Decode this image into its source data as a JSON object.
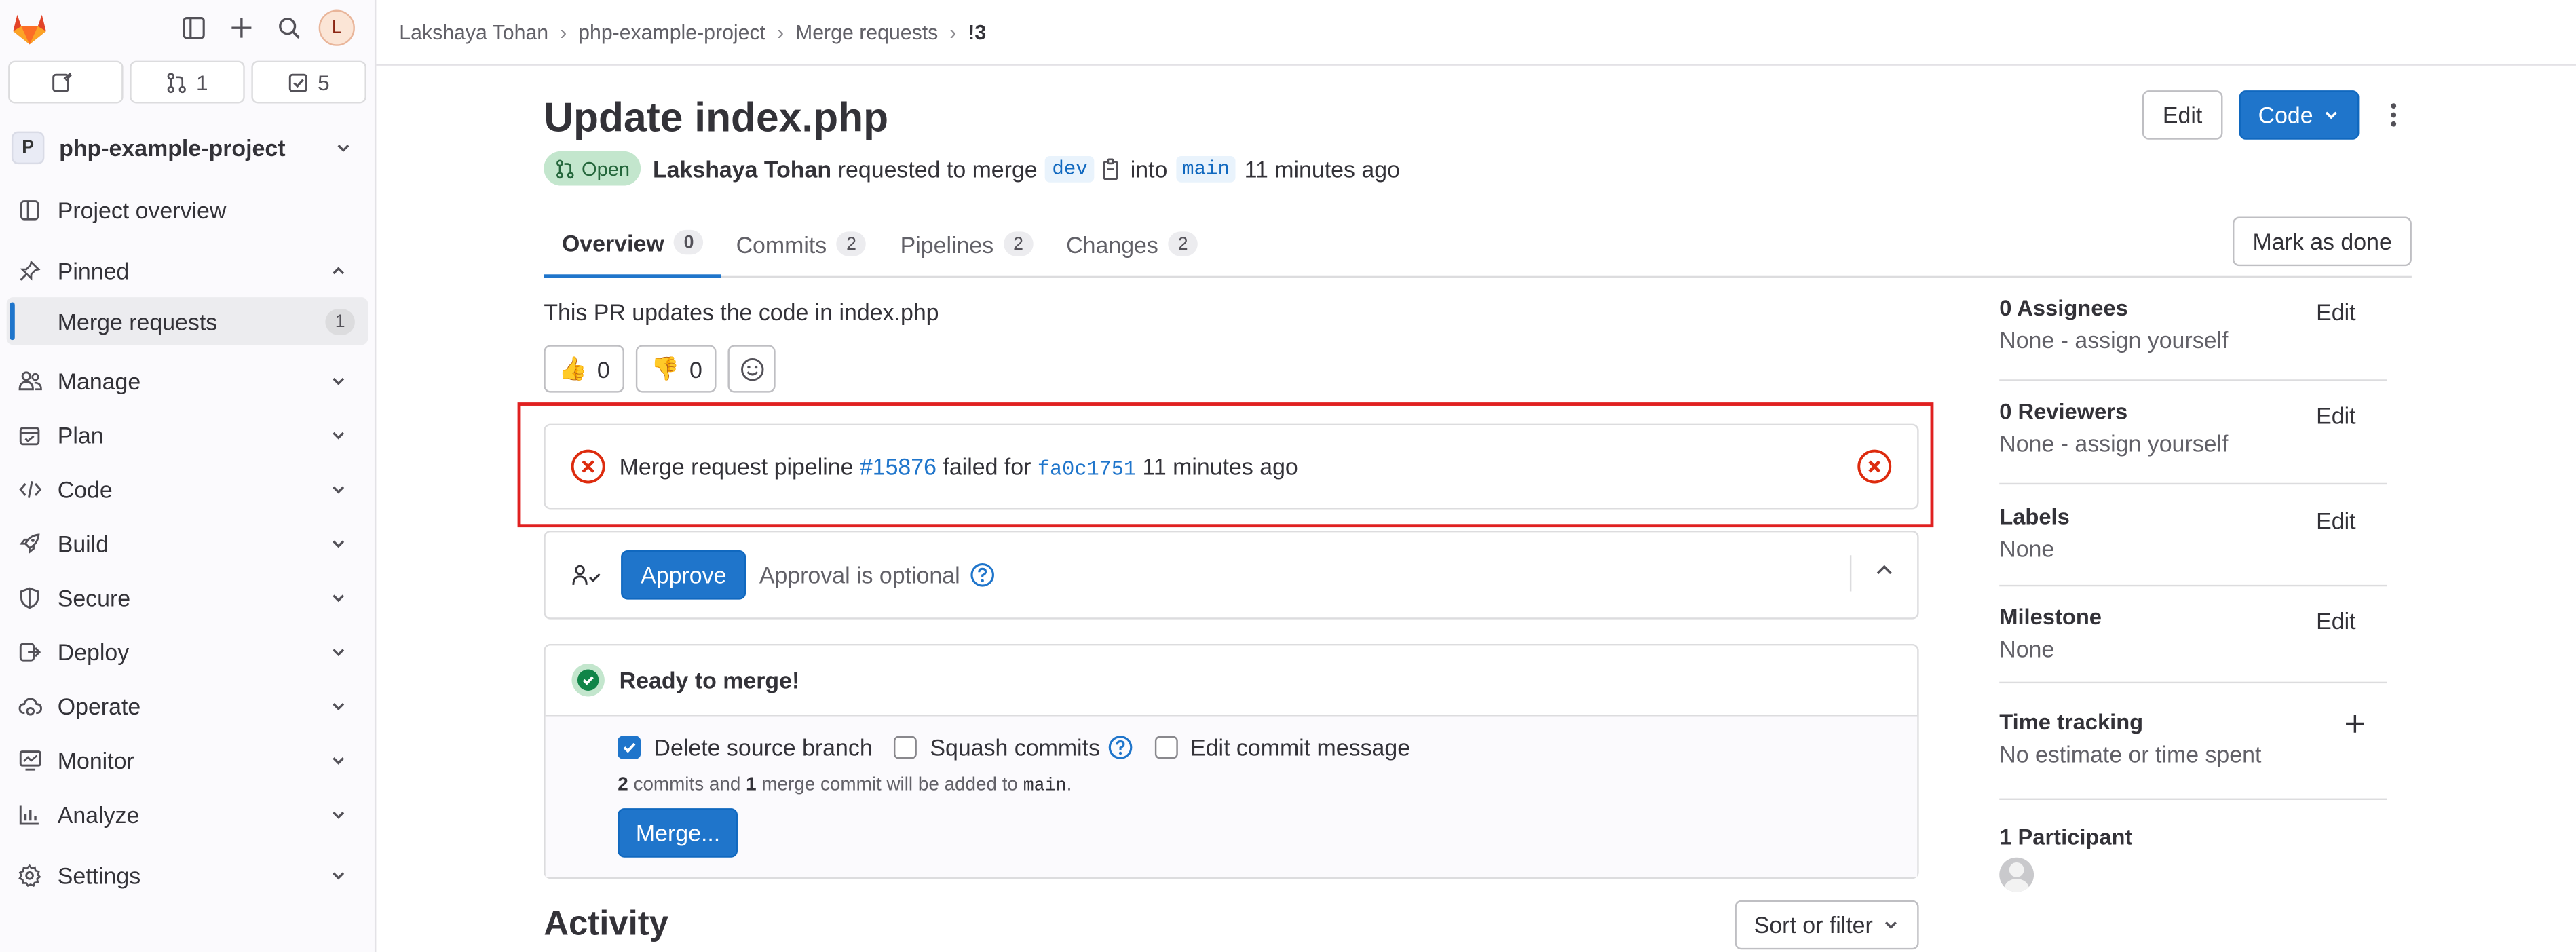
{
  "sidebar": {
    "avatar_initial": "L",
    "counts": {
      "issues": "",
      "merge_requests": "1",
      "todos": "5"
    },
    "project": {
      "initial": "P",
      "name": "php-example-project"
    },
    "items": {
      "overview": "Project overview",
      "pinned": "Pinned",
      "pinned_mr": "Merge requests",
      "pinned_mr_count": "1",
      "manage": "Manage",
      "plan": "Plan",
      "code": "Code",
      "build": "Build",
      "secure": "Secure",
      "deploy": "Deploy",
      "operate": "Operate",
      "monitor": "Monitor",
      "analyze": "Analyze",
      "settings": "Settings"
    }
  },
  "breadcrumb": [
    "Lakshaya Tohan",
    "php-example-project",
    "Merge requests",
    "!3"
  ],
  "header": {
    "title": "Update index.php",
    "edit_label": "Edit",
    "code_label": "Code",
    "status": "Open",
    "author": "Lakshaya Tohan",
    "requested_text": "requested to merge",
    "source_branch": "dev",
    "into_text": "into",
    "target_branch": "main",
    "time": "11 minutes ago"
  },
  "tabs": [
    {
      "label": "Overview",
      "count": "0"
    },
    {
      "label": "Commits",
      "count": "2"
    },
    {
      "label": "Pipelines",
      "count": "2"
    },
    {
      "label": "Changes",
      "count": "2"
    }
  ],
  "mark_done_label": "Mark as done",
  "description": "This PR updates the code in index.php",
  "reactions": {
    "thumbs_up": "0",
    "thumbs_down": "0"
  },
  "pipeline": {
    "prefix": "Merge request pipeline",
    "id": "#15876",
    "failed_for": "failed for",
    "commit": "fa0c1751",
    "time": "11 minutes ago"
  },
  "approval": {
    "button": "Approve",
    "text": "Approval is optional"
  },
  "merge": {
    "ready": "Ready to merge!",
    "delete_branch": "Delete source branch",
    "squash": "Squash commits",
    "edit_message": "Edit commit message",
    "note_commits": "2",
    "note_mid": "commits and",
    "note_merge": "1",
    "note_tail": "merge commit will be added to",
    "note_branch": "main",
    "note_end": ".",
    "button": "Merge..."
  },
  "activity": {
    "title": "Activity",
    "sort_label": "Sort or filter"
  },
  "right_sidebar": {
    "assignees": {
      "title": "0 Assignees",
      "value": "None - assign yourself",
      "edit": "Edit"
    },
    "reviewers": {
      "title": "0 Reviewers",
      "value": "None - assign yourself",
      "edit": "Edit"
    },
    "labels": {
      "title": "Labels",
      "value": "None",
      "edit": "Edit"
    },
    "milestone": {
      "title": "Milestone",
      "value": "None",
      "edit": "Edit"
    },
    "time_tracking": {
      "title": "Time tracking",
      "value": "No estimate or time spent"
    },
    "participants": {
      "title": "1 Participant"
    }
  },
  "colors": {
    "accent": "#1f75cb",
    "danger": "#dd2b0e",
    "success": "#108548",
    "highlight_box": "#e02020"
  }
}
